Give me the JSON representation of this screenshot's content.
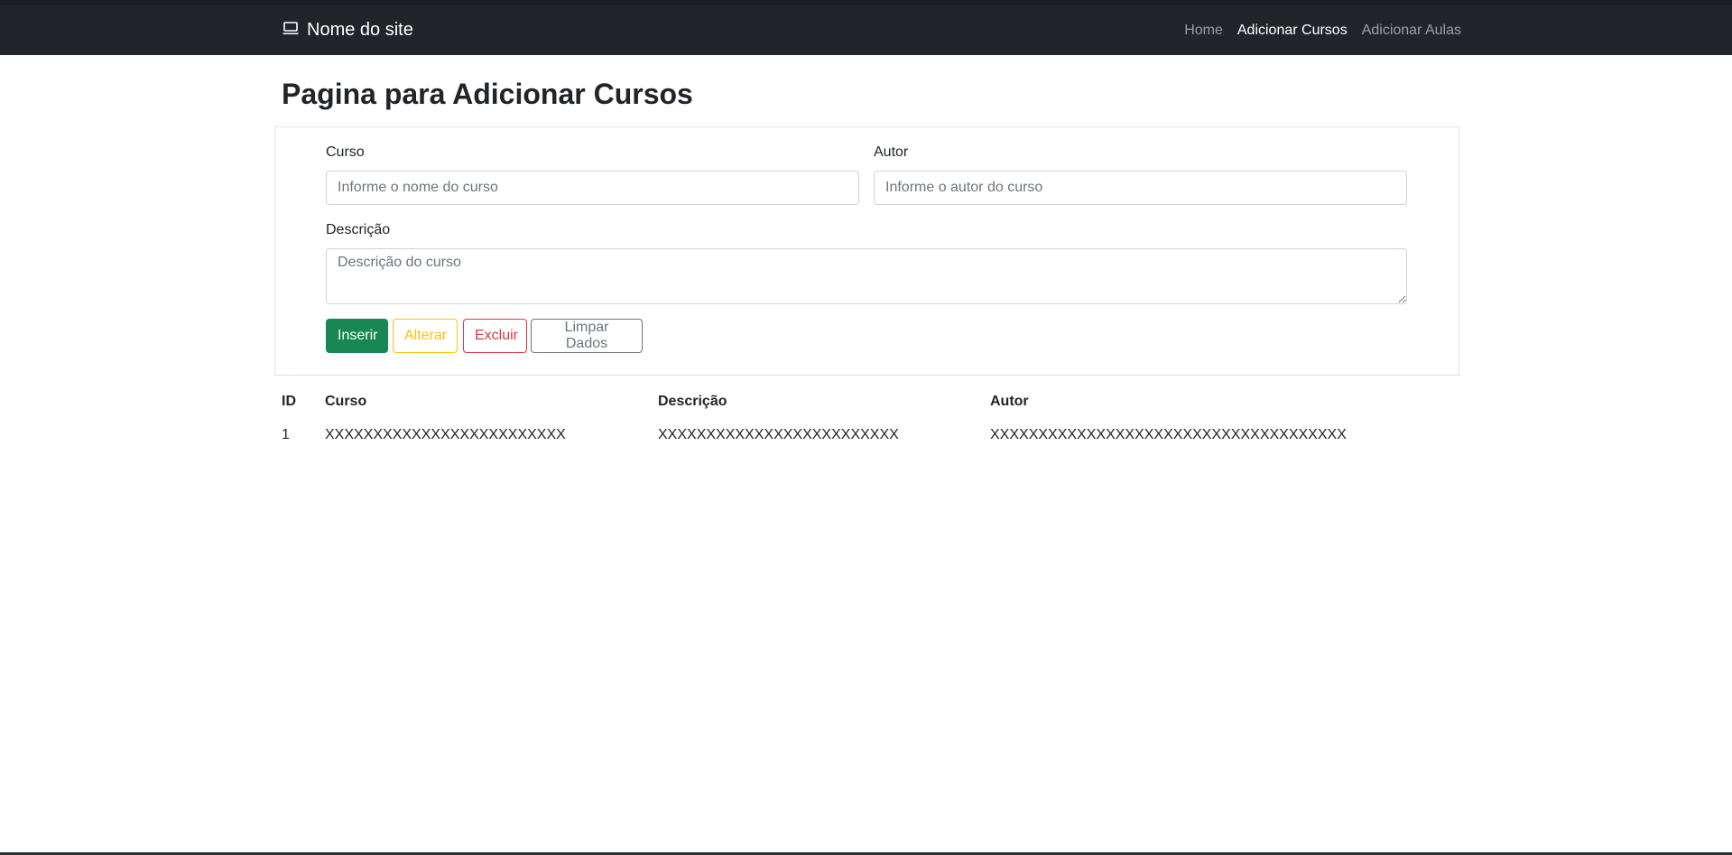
{
  "navbar": {
    "brand": "Nome do site",
    "brand_icon": "laptop-icon",
    "links": [
      {
        "label": "Home"
      },
      {
        "label": "Adicionar Cursos",
        "active": true
      },
      {
        "label": "Adicionar Aulas"
      }
    ]
  },
  "page": {
    "title": "Pagina para Adicionar Cursos"
  },
  "form": {
    "curso_label": "Curso",
    "curso_placeholder": "Informe o nome do curso",
    "autor_label": "Autor",
    "autor_placeholder": "Informe o autor do curso",
    "descricao_label": "Descrição",
    "descricao_placeholder": "Descrição do curso",
    "buttons": {
      "insert": "Inserir",
      "update": "Alterar",
      "delete": "Excluir",
      "clear": "Limpar Dados"
    }
  },
  "table": {
    "headers": [
      "ID",
      "Curso",
      "Descrição",
      "Autor"
    ],
    "rows": [
      [
        "1",
        "XXXXXXXXXXXXXXXXXXXXXXXXX",
        "XXXXXXXXXXXXXXXXXXXXXXXXX",
        "XXXXXXXXXXXXXXXXXXXXXXXXXXXXXXXXXXXXX"
      ]
    ]
  },
  "colors": {
    "navbar_bg": "#212529",
    "success": "#198754",
    "warning": "#ffc107",
    "danger": "#dc3545",
    "secondary": "#6c757d"
  }
}
